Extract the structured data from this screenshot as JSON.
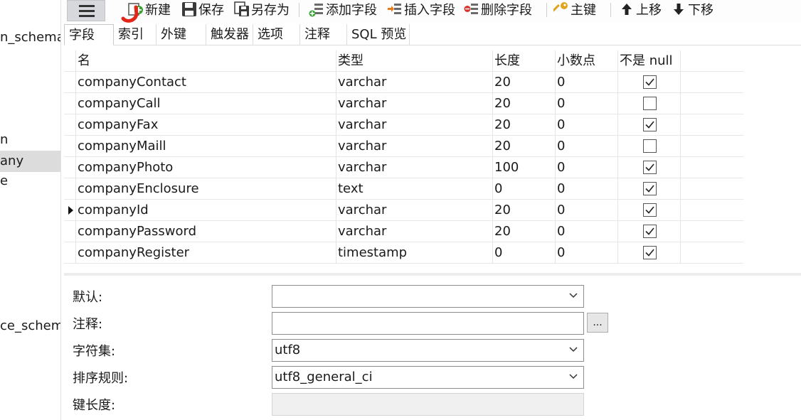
{
  "left_panel": {
    "items": [
      {
        "label": "n_schema",
        "selected": false
      },
      {
        "label": "n",
        "selected": false
      },
      {
        "label": "any",
        "selected": true
      },
      {
        "label": "e",
        "selected": false
      },
      {
        "label": "ce_schema",
        "selected": false
      }
    ]
  },
  "toolbar": {
    "new_label": "新建",
    "save_label": "保存",
    "save_as_label": "另存为",
    "add_field_label": "添加字段",
    "insert_field_label": "插入字段",
    "delete_field_label": "删除字段",
    "primary_key_label": "主键",
    "move_up_label": "上移",
    "move_down_label": "下移"
  },
  "tabs": [
    {
      "label": "字段",
      "active": true
    },
    {
      "label": "索引",
      "active": false
    },
    {
      "label": "外键",
      "active": false
    },
    {
      "label": "触发器",
      "active": false
    },
    {
      "label": "选项",
      "active": false
    },
    {
      "label": "注释",
      "active": false
    },
    {
      "label": "SQL 预览",
      "active": false
    }
  ],
  "grid": {
    "headers": {
      "name": "名",
      "type": "类型",
      "length": "长度",
      "decimals": "小数点",
      "not_null": "不是 null"
    },
    "rows": [
      {
        "name": "companyContact",
        "type": "varchar",
        "length": "20",
        "decimals": "0",
        "not_null": true,
        "current": false
      },
      {
        "name": "companyCall",
        "type": "varchar",
        "length": "20",
        "decimals": "0",
        "not_null": false,
        "current": false
      },
      {
        "name": "companyFax",
        "type": "varchar",
        "length": "20",
        "decimals": "0",
        "not_null": true,
        "current": false
      },
      {
        "name": "companyMaill",
        "type": "varchar",
        "length": "20",
        "decimals": "0",
        "not_null": false,
        "current": false
      },
      {
        "name": "companyPhoto",
        "type": "varchar",
        "length": "100",
        "decimals": "0",
        "not_null": true,
        "current": false
      },
      {
        "name": "companyEnclosure",
        "type": "text",
        "length": "0",
        "decimals": "0",
        "not_null": true,
        "current": false
      },
      {
        "name": "companyId",
        "type": "varchar",
        "length": "20",
        "decimals": "0",
        "not_null": true,
        "current": true
      },
      {
        "name": "companyPassword",
        "type": "varchar",
        "length": "20",
        "decimals": "0",
        "not_null": true,
        "current": false
      },
      {
        "name": "companyRegister",
        "type": "timestamp",
        "length": "0",
        "decimals": "0",
        "not_null": true,
        "current": false
      }
    ]
  },
  "properties": {
    "default_label": "默认:",
    "default_value": "",
    "comment_label": "注释:",
    "comment_value": "",
    "comment_button": "...",
    "charset_label": "字符集:",
    "charset_value": "utf8",
    "collation_label": "排序规则:",
    "collation_value": "utf8_general_ci",
    "key_length_label": "键长度:",
    "key_length_value": ""
  },
  "colors": {
    "selected_bg": "#dcdcdc",
    "new_icon_green": "#3aa335",
    "delete_icon_red": "#d9342b",
    "key_icon_gold": "#e1a31c",
    "cursor_red": "#e32619"
  }
}
